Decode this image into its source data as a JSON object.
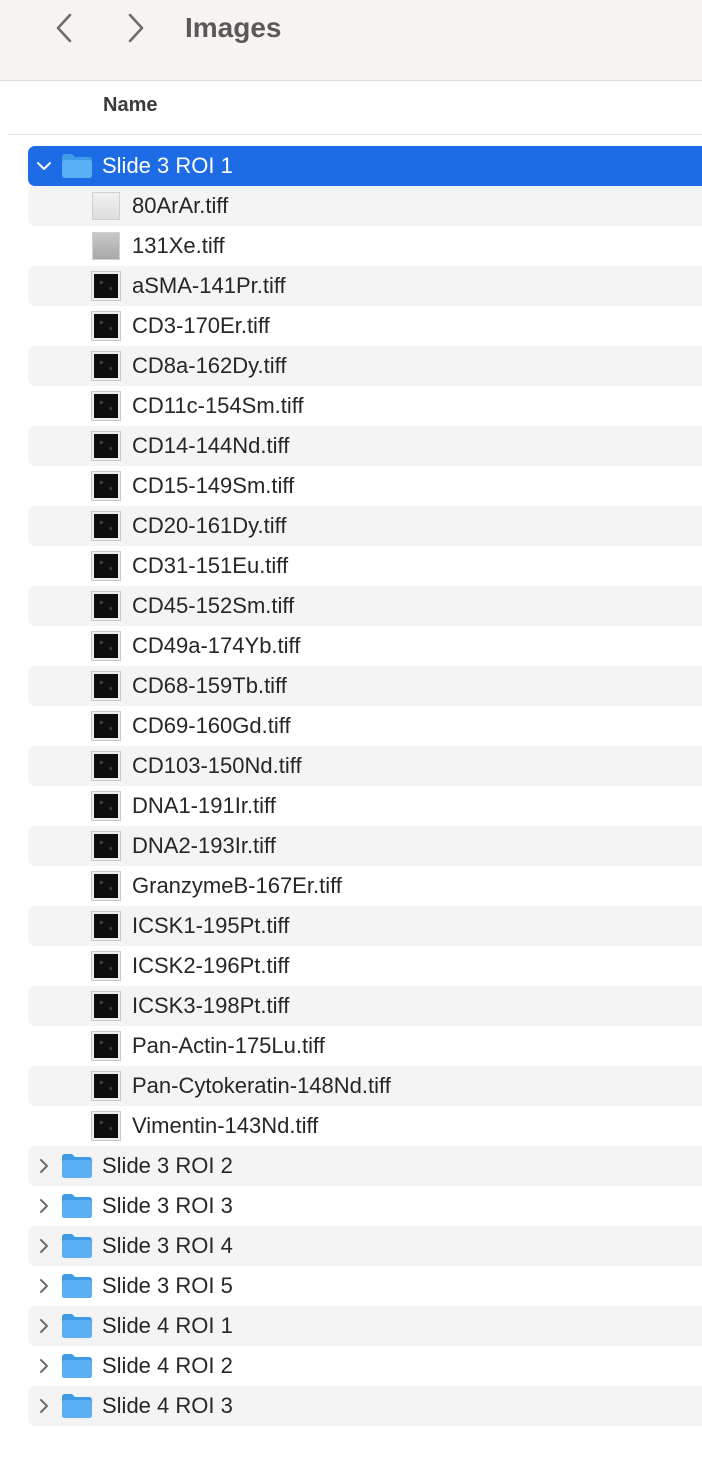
{
  "toolbar": {
    "title": "Images",
    "back_icon": "chevron-left-icon",
    "forward_icon": "chevron-right-icon"
  },
  "columns": {
    "name": "Name"
  },
  "colors": {
    "selection": "#1d6ce6",
    "folder": "#5ab0f2",
    "stripe": "#f4f4f4"
  },
  "rows": [
    {
      "type": "folder",
      "label": "Slide 3 ROI 1",
      "expanded": true,
      "selected": true
    },
    {
      "type": "file",
      "label": "80ArAr.tiff",
      "thumb": "light"
    },
    {
      "type": "file",
      "label": "131Xe.tiff",
      "thumb": "gray"
    },
    {
      "type": "file",
      "label": "aSMA-141Pr.tiff",
      "thumb": "dark"
    },
    {
      "type": "file",
      "label": "CD3-170Er.tiff",
      "thumb": "dark"
    },
    {
      "type": "file",
      "label": "CD8a-162Dy.tiff",
      "thumb": "dark"
    },
    {
      "type": "file",
      "label": "CD11c-154Sm.tiff",
      "thumb": "dark"
    },
    {
      "type": "file",
      "label": "CD14-144Nd.tiff",
      "thumb": "dark"
    },
    {
      "type": "file",
      "label": "CD15-149Sm.tiff",
      "thumb": "dark"
    },
    {
      "type": "file",
      "label": "CD20-161Dy.tiff",
      "thumb": "dark"
    },
    {
      "type": "file",
      "label": "CD31-151Eu.tiff",
      "thumb": "dark"
    },
    {
      "type": "file",
      "label": "CD45-152Sm.tiff",
      "thumb": "dark"
    },
    {
      "type": "file",
      "label": "CD49a-174Yb.tiff",
      "thumb": "dark"
    },
    {
      "type": "file",
      "label": "CD68-159Tb.tiff",
      "thumb": "dark"
    },
    {
      "type": "file",
      "label": "CD69-160Gd.tiff",
      "thumb": "dark"
    },
    {
      "type": "file",
      "label": "CD103-150Nd.tiff",
      "thumb": "dark"
    },
    {
      "type": "file",
      "label": "DNA1-191Ir.tiff",
      "thumb": "dark"
    },
    {
      "type": "file",
      "label": "DNA2-193Ir.tiff",
      "thumb": "dark"
    },
    {
      "type": "file",
      "label": "GranzymeB-167Er.tiff",
      "thumb": "dark"
    },
    {
      "type": "file",
      "label": "ICSK1-195Pt.tiff",
      "thumb": "dark"
    },
    {
      "type": "file",
      "label": "ICSK2-196Pt.tiff",
      "thumb": "dark"
    },
    {
      "type": "file",
      "label": "ICSK3-198Pt.tiff",
      "thumb": "dark"
    },
    {
      "type": "file",
      "label": "Pan-Actin-175Lu.tiff",
      "thumb": "dark"
    },
    {
      "type": "file",
      "label": "Pan-Cytokeratin-148Nd.tiff",
      "thumb": "dark"
    },
    {
      "type": "file",
      "label": "Vimentin-143Nd.tiff",
      "thumb": "dark"
    },
    {
      "type": "folder",
      "label": "Slide 3 ROI 2",
      "expanded": false
    },
    {
      "type": "folder",
      "label": "Slide 3 ROI 3",
      "expanded": false
    },
    {
      "type": "folder",
      "label": "Slide 3 ROI 4",
      "expanded": false
    },
    {
      "type": "folder",
      "label": "Slide 3 ROI 5",
      "expanded": false
    },
    {
      "type": "folder",
      "label": "Slide 4 ROI 1",
      "expanded": false
    },
    {
      "type": "folder",
      "label": "Slide 4 ROI 2",
      "expanded": false
    },
    {
      "type": "folder",
      "label": "Slide 4 ROI 3",
      "expanded": false
    }
  ]
}
